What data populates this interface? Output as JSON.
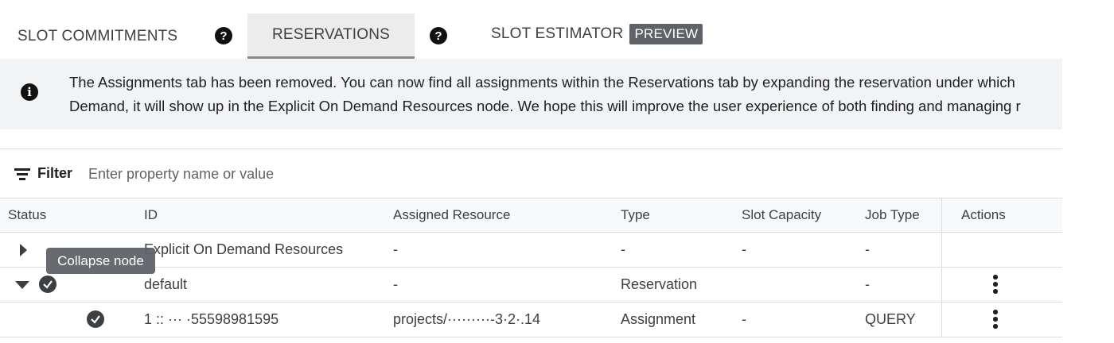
{
  "tabs": [
    {
      "label": "SLOT COMMITMENTS",
      "active": false
    },
    {
      "label": "RESERVATIONS",
      "active": true
    },
    {
      "label": "SLOT ESTIMATOR",
      "badge": "PREVIEW",
      "active": false
    }
  ],
  "help_icon_glyph": "?",
  "banner": {
    "icon": "info-icon",
    "line1": "The Assignments tab has been removed. You can now find all assignments within the Reservations tab by expanding the reservation under which",
    "line2": "Demand, it will show up in the Explicit On Demand Resources node. We hope this will improve the user experience of both finding and managing r"
  },
  "filter": {
    "label": "Filter",
    "placeholder": "Enter property name or value"
  },
  "table": {
    "columns": [
      "Status",
      "ID",
      "Assigned Resource",
      "Type",
      "Slot Capacity",
      "Job Type",
      "Actions"
    ],
    "rows": [
      {
        "expander": "expand",
        "status": "",
        "id": "Explicit On Demand Resources",
        "resource": "-",
        "type": "-",
        "capacity": "-",
        "job_type": "-",
        "has_actions": false
      },
      {
        "expander": "collapse",
        "status": "active",
        "id": "default",
        "resource": "-",
        "type": "Reservation",
        "capacity": "",
        "job_type": "-",
        "has_actions": true
      },
      {
        "expander": "",
        "status": "active",
        "id": "1 :: ··· ·55598981595",
        "resource": "projects/·········-3·2·.14",
        "type": "Assignment",
        "capacity": "-",
        "job_type": "QUERY",
        "has_actions": true
      }
    ]
  },
  "tooltip": "Collapse node",
  "colors": {
    "banner_bg": "#f1f3f4",
    "badge_bg": "#5f6368",
    "active_tab_bg": "#ececec"
  }
}
